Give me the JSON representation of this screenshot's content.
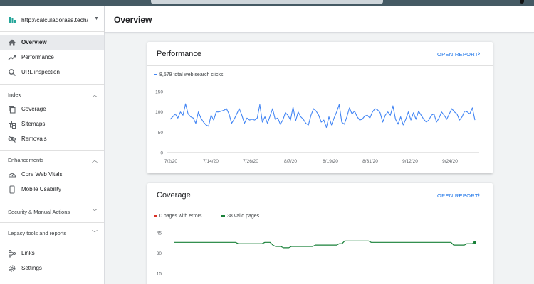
{
  "property": {
    "url": "http://calculadorass.tech/"
  },
  "header": {
    "title": "Overview"
  },
  "sidebar": {
    "items": [
      {
        "label": "Overview",
        "icon": "home-icon"
      },
      {
        "label": "Performance",
        "icon": "trending-up-icon"
      },
      {
        "label": "URL inspection",
        "icon": "search-icon"
      }
    ],
    "index": {
      "title": "Index",
      "items": [
        {
          "label": "Coverage",
          "icon": "copy-icon"
        },
        {
          "label": "Sitemaps",
          "icon": "sitemap-icon"
        },
        {
          "label": "Removals",
          "icon": "eye-off-icon"
        }
      ]
    },
    "enhancements": {
      "title": "Enhancements",
      "items": [
        {
          "label": "Core Web Vitals",
          "icon": "speedometer-icon"
        },
        {
          "label": "Mobile Usability",
          "icon": "phone-icon"
        }
      ]
    },
    "security": {
      "title": "Security & Manual Actions"
    },
    "legacy": {
      "title": "Legacy tools and reports"
    },
    "bottom": [
      {
        "label": "Links",
        "icon": "links-icon"
      },
      {
        "label": "Settings",
        "icon": "gear-icon"
      }
    ]
  },
  "cards": {
    "performance": {
      "title": "Performance",
      "open_label": "OPEN REPORT"
    },
    "coverage": {
      "title": "Coverage",
      "open_label": "OPEN REPORT"
    }
  },
  "colors": {
    "accent": "#1a73e8",
    "clicks": "#4285f4",
    "errors": "#d93025",
    "valid": "#188038"
  },
  "chart_data": [
    {
      "type": "line",
      "series": [
        {
          "name": "8,579 total web search clicks",
          "values": [
            82,
            88,
            95,
            85,
            100,
            92,
            120,
            95,
            88,
            85,
            72,
            100,
            85,
            75,
            68,
            65,
            92,
            80,
            100,
            100,
            102,
            104,
            108,
            95,
            72,
            82,
            95,
            108,
            92,
            72,
            85,
            80,
            82,
            80,
            85,
            118,
            75,
            88,
            72,
            90,
            108,
            82,
            85,
            70,
            80,
            98,
            92,
            80,
            112,
            78,
            100,
            88,
            82,
            72,
            68,
            92,
            108,
            102,
            92,
            75,
            80,
            62,
            88,
            68,
            85,
            100,
            118,
            75,
            70,
            88,
            110,
            95,
            102,
            88,
            80,
            82,
            90,
            92,
            85,
            100,
            108,
            105,
            98,
            75,
            92,
            100,
            92,
            115,
            82,
            70,
            88,
            68,
            82,
            100,
            80,
            98,
            82,
            102,
            92,
            82,
            75,
            80,
            92,
            95,
            75,
            85,
            100,
            92,
            82,
            95,
            108,
            100,
            95,
            80,
            88,
            102,
            100,
            95,
            110,
            80
          ]
        }
      ],
      "x_tick_labels": [
        "7/2/20",
        "7/14/20",
        "7/26/20",
        "8/7/20",
        "8/19/20",
        "8/31/20",
        "9/12/20",
        "9/24/20"
      ],
      "y_ticks": [
        0,
        50,
        100,
        150
      ],
      "ylim": [
        0,
        150
      ]
    },
    {
      "type": "line",
      "series": [
        {
          "name": "0 pages with errors",
          "values": [
            0
          ]
        },
        {
          "name": "38 valid pages",
          "values": [
            38,
            38,
            38,
            38,
            38,
            38,
            38,
            38,
            38,
            38,
            38,
            38,
            38,
            38,
            38,
            38,
            38,
            38,
            38,
            38,
            38,
            38,
            38,
            38,
            37,
            37,
            37,
            37,
            37,
            37,
            37,
            37,
            37,
            37,
            38,
            38,
            38,
            36,
            35,
            35,
            35,
            34,
            34,
            34,
            35,
            35,
            35,
            35,
            35,
            35,
            35,
            35,
            35,
            36,
            36,
            36,
            36,
            36,
            36,
            36,
            36,
            36,
            37,
            37,
            39,
            39,
            39,
            39,
            39,
            39,
            39,
            39,
            39,
            39,
            38,
            38,
            38,
            38,
            38,
            38,
            38,
            38,
            38,
            38,
            38,
            38,
            38,
            38,
            38,
            38,
            38,
            38,
            38,
            38,
            38,
            38,
            38,
            38,
            38,
            38,
            38,
            38,
            38,
            38,
            38,
            36,
            36,
            36,
            36,
            36,
            37,
            37,
            37,
            38
          ]
        }
      ],
      "y_ticks": [
        15,
        30,
        45
      ],
      "ylim": [
        15,
        45
      ]
    }
  ]
}
